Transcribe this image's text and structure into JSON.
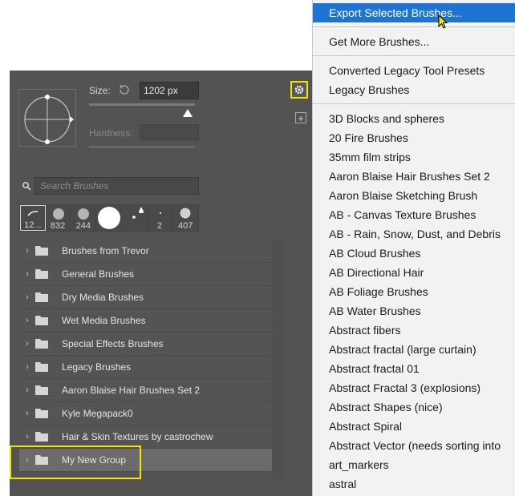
{
  "brush_panel": {
    "size_label": "Size:",
    "size_value": "1202 px",
    "size_slider_fraction": 0.9,
    "hardness_label": "Hardness:",
    "search_placeholder": "Search Brushes",
    "presets": [
      {
        "label": "12...",
        "icon": "brush-stroke-icon",
        "selected": true
      },
      {
        "label": "832",
        "icon": "soft-round-brush-icon"
      },
      {
        "label": "244",
        "icon": "soft-round-brush-icon"
      },
      {
        "label": "",
        "icon": "hard-round-brush-icon"
      },
      {
        "label": "",
        "icon": "small-dot-brush-icon"
      },
      {
        "label": "2",
        "icon": "tiny-dot-brush-icon"
      },
      {
        "label": "407",
        "icon": "textured-round-brush-icon"
      }
    ],
    "groups": [
      "Brushes from Trevor",
      "General Brushes",
      "Dry Media Brushes",
      "Wet Media Brushes",
      "Special Effects Brushes",
      "Legacy Brushes",
      "Aaron Blaise Hair Brushes Set 2",
      "Kyle Megapack0",
      "Hair & Skin Textures by castrochew",
      "My New Group"
    ],
    "selected_group": "My New Group"
  },
  "menu": {
    "highlighted": "Export Selected Brushes...",
    "section1": [
      "Export Selected Brushes..."
    ],
    "section2": [
      "Get More Brushes..."
    ],
    "section3": [
      "Converted Legacy Tool Presets",
      "Legacy Brushes"
    ],
    "section4": [
      "3D Blocks and spheres",
      "20 Fire Brushes",
      "35mm film strips",
      "Aaron Blaise Hair Brushes Set 2",
      "Aaron Blaise Sketching Brush",
      "AB - Canvas Texture Brushes",
      "AB - Rain, Snow, Dust, and Debris",
      "AB Cloud Brushes",
      "AB Directional Hair",
      "AB Foliage Brushes",
      "AB Water Brushes",
      "Abstract fibers",
      "Abstract fractal (large curtain)",
      "Abstract fractal 01",
      "Abstract Fractal 3 (explosions)",
      "Abstract Shapes (nice)",
      "Abstract Spiral",
      "Abstract Vector (needs sorting into",
      "art_markers",
      "astral"
    ]
  },
  "colors": {
    "panel_bg": "#535353",
    "highlight_outline": "#f3e600",
    "menu_highlight": "#1e74d2",
    "menu_bg": "#f2f2f2"
  }
}
